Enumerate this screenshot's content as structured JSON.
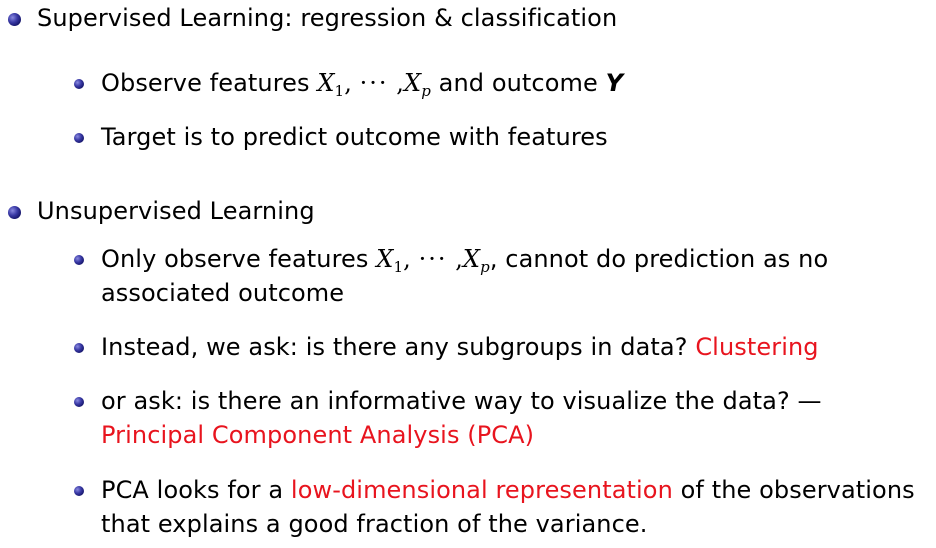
{
  "items": [
    {
      "text": "Supervised Learning: regression & classification",
      "children": [
        {
          "pre": "Observe features ",
          "math_var": "X",
          "sub_first": "1",
          "math_sep": ",",
          "math_dots": "···",
          "math_sep2": ",",
          "math_var2": "X",
          "sub_last": "p",
          "post": " and outcome ",
          "bold_var": "Y"
        },
        {
          "text": "Target is to predict outcome with features"
        }
      ]
    },
    {
      "text": "Unsupervised Learning",
      "children": [
        {
          "pre": "Only observe features ",
          "math_var": "X",
          "sub_first": "1",
          "math_sep": ",",
          "math_dots": "···",
          "math_sep2": ",",
          "math_var2": "X",
          "sub_last": "p",
          "post": ", cannot do prediction as no",
          "line2": "associated outcome"
        },
        {
          "pre": "Instead, we ask: is there any subgroups in data? ",
          "highlight": "Clustering"
        },
        {
          "pre": "or ask: is there an informative way to visualize the data? —",
          "line2_highlight": "Principal Component Analysis (PCA)"
        },
        {
          "pre": "PCA looks for a ",
          "highlight": "low-dimensional representation",
          "post": " of the observations",
          "line2": "that explains a good fraction of the variance."
        }
      ]
    }
  ],
  "colors": {
    "text": "#000000",
    "highlight": "#e8141e",
    "bullet": "#2a2a8a"
  }
}
